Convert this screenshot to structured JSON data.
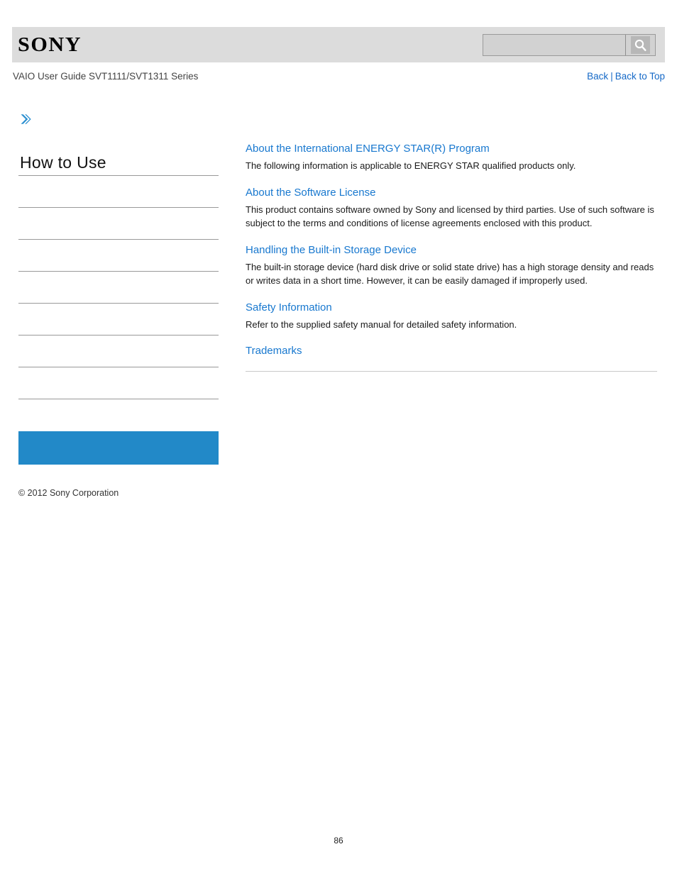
{
  "header": {
    "logo_text": "SONY",
    "logo_icon": "sony-wordmark",
    "search": {
      "value": "",
      "placeholder": "",
      "icon": "search-icon"
    }
  },
  "subheader": {
    "guide_title": "VAIO User Guide SVT1111/SVT1311 Series",
    "back_label": "Back",
    "separator": "|",
    "back_to_top_label": "Back to Top"
  },
  "sidebar": {
    "chevron_icon": "chevron-double-right-icon",
    "title": "How to Use",
    "items": [
      {
        "label": ""
      },
      {
        "label": ""
      },
      {
        "label": ""
      },
      {
        "label": ""
      },
      {
        "label": ""
      },
      {
        "label": ""
      },
      {
        "label": ""
      }
    ],
    "highlight_panel": {
      "label": "",
      "color": "#2289c8"
    },
    "copyright": "© 2012 Sony Corporation"
  },
  "content": {
    "sections": [
      {
        "heading": "About the International ENERGY STAR(R) Program",
        "body": "The following information is applicable to ENERGY STAR qualified products only."
      },
      {
        "heading": "About the Software License",
        "body": "This product contains software owned by Sony and licensed by third parties. Use of such software is subject to the terms and conditions of license agreements enclosed with this product."
      },
      {
        "heading": "Handling the Built-in Storage Device",
        "body": "The built-in storage device (hard disk drive or solid state drive) has a high storage density and reads or writes data in a short time. However, it can be easily damaged if improperly used."
      },
      {
        "heading": "Safety Information",
        "body": "Refer to the supplied safety manual for detailed safety information."
      },
      {
        "heading": "Trademarks",
        "body": ""
      }
    ]
  },
  "footer": {
    "page_number": "86"
  },
  "colors": {
    "link_blue": "#1569c7",
    "heading_blue": "#1878cf",
    "panel_blue": "#2289c8",
    "band_gray": "#dcdcdc",
    "rule_gray": "#999999"
  }
}
